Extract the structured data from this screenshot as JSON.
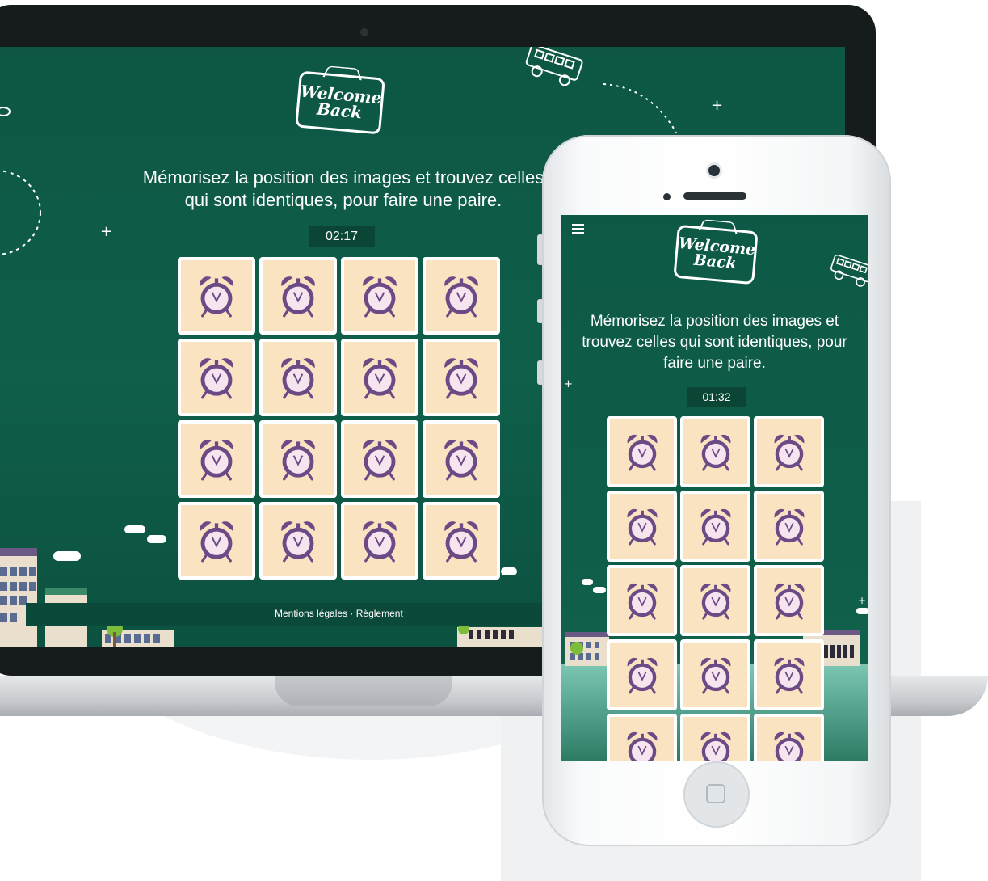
{
  "sign": {
    "line1": "Welcome",
    "line2": "Back"
  },
  "laptop": {
    "instruction_line1": "Mémorisez la position des images et trouvez celles",
    "instruction_line2": "qui sont identiques, pour faire une paire.",
    "timer": "02:17",
    "grid": {
      "columns": 4,
      "rows": 4,
      "card_icon": "alarm-clock-icon"
    },
    "footer": {
      "mentions": "Mentions légales",
      "separator": "·",
      "reglement": "Règlement"
    }
  },
  "phone": {
    "instruction_line1": "Mémorisez la position des images et",
    "instruction_line2": "trouvez celles qui sont identiques, pour",
    "instruction_line3": "faire une paire.",
    "timer": "01:32",
    "grid": {
      "columns": 3,
      "rows_visible": 5,
      "card_icon": "alarm-clock-icon"
    },
    "menu_icon": "hamburger-menu-icon"
  },
  "colors": {
    "chalkboard": "#0f5f4a",
    "card": "#f9e3c0",
    "clock": "#6b4a86",
    "timer_bg": "#0a4535"
  }
}
